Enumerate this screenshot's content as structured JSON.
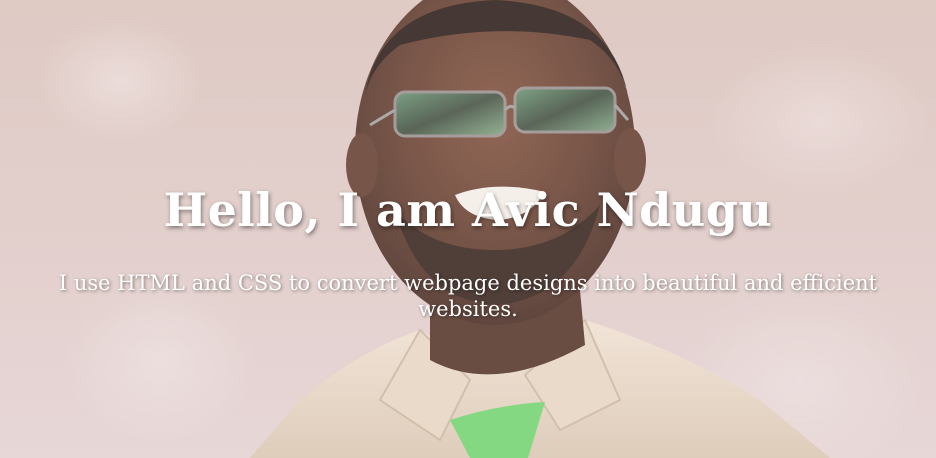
{
  "hero": {
    "title": "Hello, I am Avic Ndugu",
    "subtitle": "I use HTML and CSS to convert webpage designs into beautiful and efficient websites."
  },
  "colors": {
    "background": "#dcc8c4",
    "text": "#ffffff",
    "shirt": "#e8d8c4",
    "undershirt": "#6ad46a",
    "skin": "#5a3424"
  },
  "icons": {
    "portrait": "portrait-photo"
  }
}
